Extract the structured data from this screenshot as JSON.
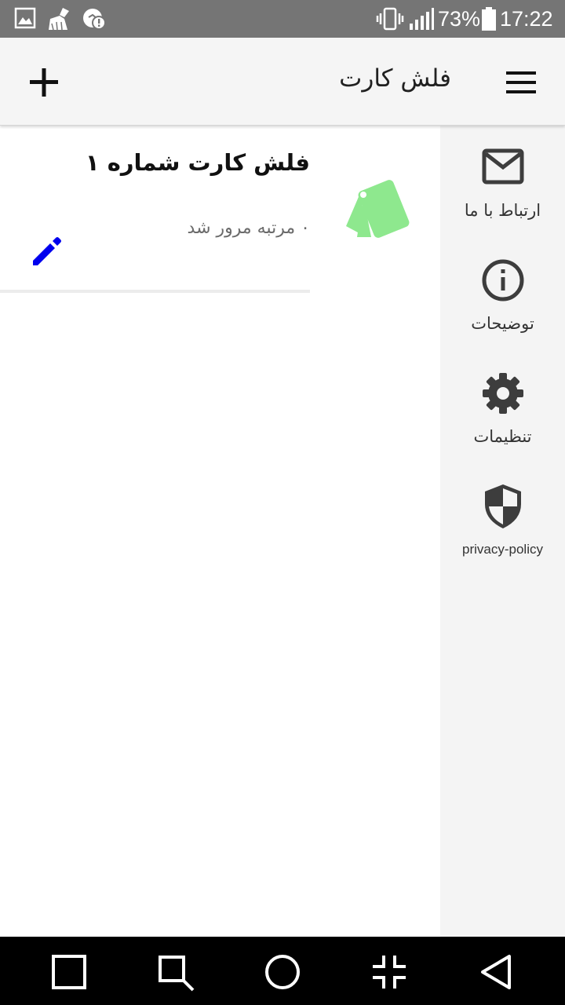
{
  "status_bar": {
    "time": "17:22",
    "battery_percent": "73%",
    "icons": [
      "gallery-icon",
      "cleaner-icon",
      "messenger-icon",
      "vibrate-icon",
      "signal-icon",
      "battery-icon"
    ],
    "background": "#757575"
  },
  "app_bar": {
    "title": "فلش کارت",
    "menu_icon": "hamburger-menu-icon",
    "add_icon": "plus-icon"
  },
  "drawer": {
    "items": [
      {
        "label": "ارتباط با ما",
        "icon": "mail-icon"
      },
      {
        "label": "توضیحات",
        "icon": "info-icon"
      },
      {
        "label": "تنظیمات",
        "icon": "gear-icon"
      },
      {
        "label": "privacy-policy",
        "icon": "shield-icon"
      }
    ],
    "background": "#f4f4f4"
  },
  "cards": [
    {
      "title": "فلش کارت شماره ۱",
      "review_text": "۰ مرتبه مرور شد",
      "icon": "flashcards-icon",
      "icon_color": "#8ee88e",
      "edit_icon": "pencil-icon",
      "edit_color": "#0000ee"
    }
  ],
  "nav_bar": {
    "buttons": [
      "recent-apps-icon",
      "screenshot-icon",
      "home-icon",
      "collapse-icon",
      "back-icon"
    ]
  }
}
